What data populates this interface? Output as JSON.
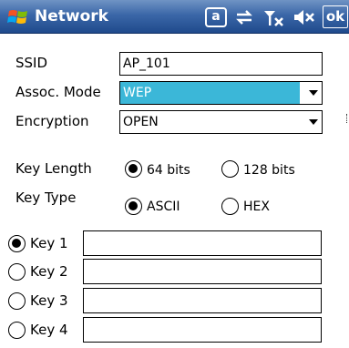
{
  "titlebar": {
    "title": "Network",
    "ok_label": "ok",
    "at_label": "a",
    "icons": [
      "windows-flag-icon",
      "sync-icon",
      "signal-icon",
      "volume-muted-icon"
    ]
  },
  "form": {
    "ssid_label": "SSID",
    "ssid_value": "AP_101",
    "assoc_label": "Assoc. Mode",
    "assoc_value": "WEP",
    "encryption_label": "Encryption",
    "encryption_value": "OPEN",
    "key_length_label": "Key Length",
    "key_length_options": [
      "64 bits",
      "128 bits"
    ],
    "key_length_selected": "64 bits",
    "key_type_label": "Key Type",
    "key_type_options": [
      "ASCII",
      "HEX"
    ],
    "key_type_selected": "ASCII",
    "keys": [
      {
        "label": "Key 1",
        "value": "",
        "selected": true
      },
      {
        "label": "Key 2",
        "value": "",
        "selected": false
      },
      {
        "label": "Key 3",
        "value": "",
        "selected": false
      },
      {
        "label": "Key 4",
        "value": "",
        "selected": false
      }
    ]
  },
  "colors": {
    "titlebar": "#3b67a8",
    "selection": "#3bb7d8"
  }
}
